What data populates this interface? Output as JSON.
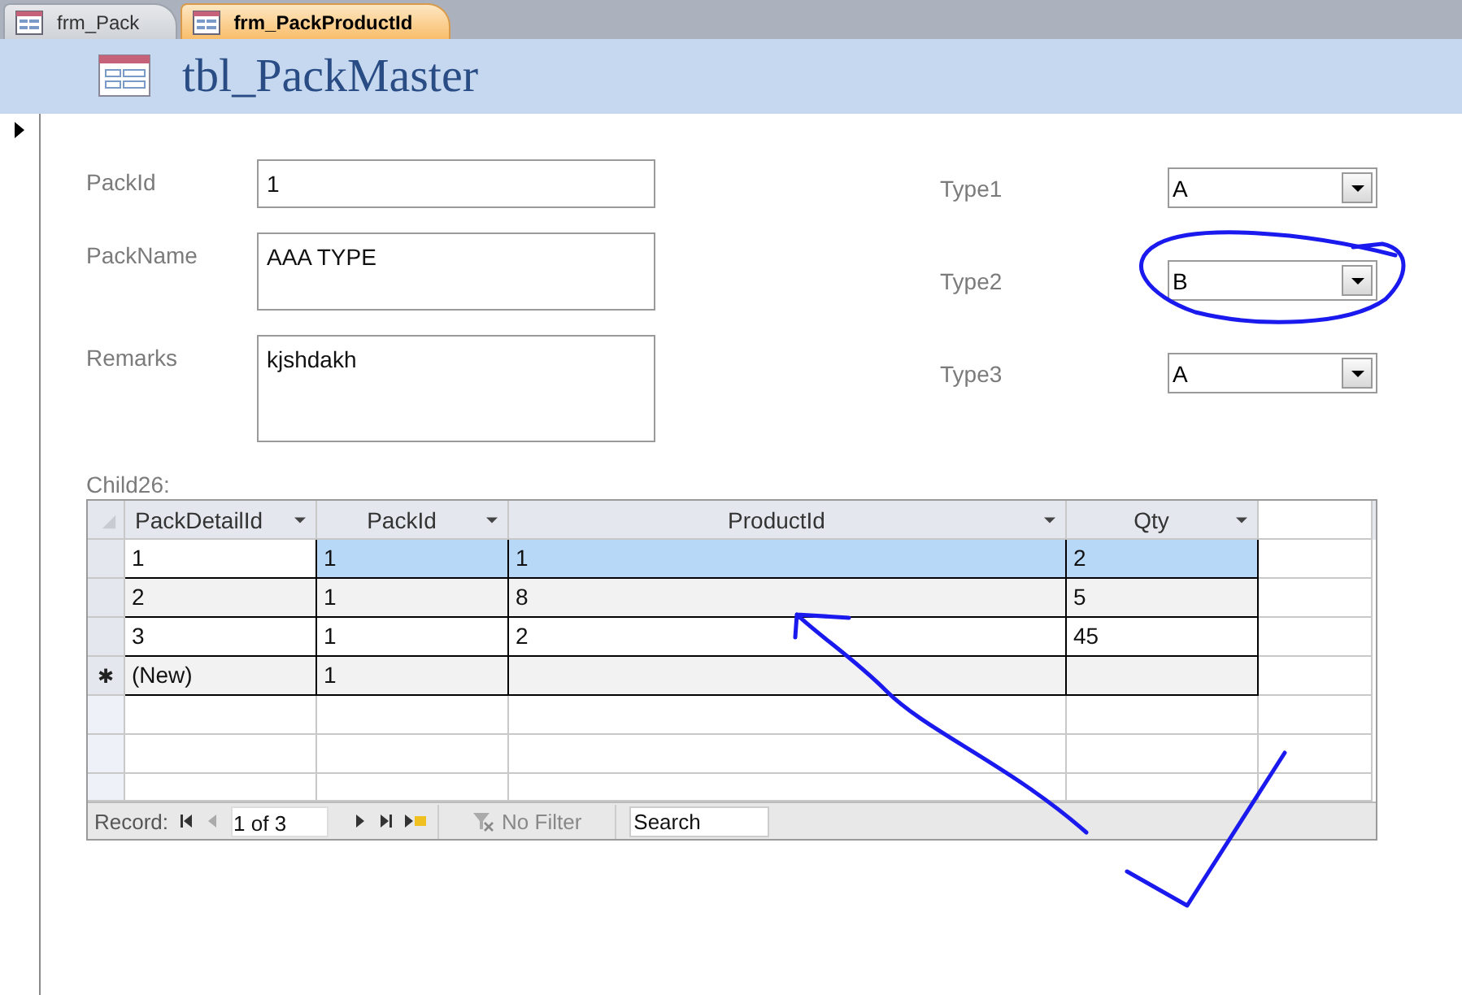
{
  "tabs": [
    {
      "label": "frm_Pack",
      "selected": false
    },
    {
      "label": "frm_PackProductId",
      "selected": true
    }
  ],
  "form_title": "tbl_PackMaster",
  "fields": [
    {
      "label": "PackId",
      "value": "1"
    },
    {
      "label": "PackName",
      "value": "AAA TYPE"
    },
    {
      "label": "Remarks",
      "value": "kjshdakh"
    }
  ],
  "combos": [
    {
      "label": "Type1",
      "value": "A"
    },
    {
      "label": "Type2",
      "value": "B"
    },
    {
      "label": "Type3",
      "value": "A"
    }
  ],
  "subform": {
    "label": "Child26:",
    "columns": [
      {
        "label": "PackDetailId"
      },
      {
        "label": "PackId"
      },
      {
        "label": "ProductId"
      },
      {
        "label": "Qty"
      }
    ],
    "rows": [
      {
        "selected": true,
        "cells": [
          "1",
          "1",
          "1",
          "2"
        ]
      },
      {
        "selected": false,
        "cells": [
          "2",
          "1",
          "8",
          "5"
        ]
      },
      {
        "selected": false,
        "cells": [
          "3",
          "1",
          "2",
          "45"
        ]
      },
      {
        "selected": false,
        "marker": "✱",
        "cells": [
          "(New)",
          "1",
          "",
          ""
        ]
      }
    ],
    "navigator": {
      "label": "Record:",
      "position": "1 of 3",
      "buttons": [
        {
          "kind": "first",
          "disabled": false
        },
        {
          "kind": "prev",
          "disabled": true
        },
        {
          "kind": "next",
          "disabled": false
        },
        {
          "kind": "last",
          "disabled": false
        },
        {
          "kind": "new",
          "disabled": false
        }
      ],
      "filter": {
        "text": "No Filter",
        "disabled": true
      },
      "search": {
        "placeholder": "Search"
      }
    }
  },
  "annotations": [
    {
      "kind": "ellipse"
    },
    {
      "kind": "arrow"
    },
    {
      "kind": "check"
    }
  ]
}
